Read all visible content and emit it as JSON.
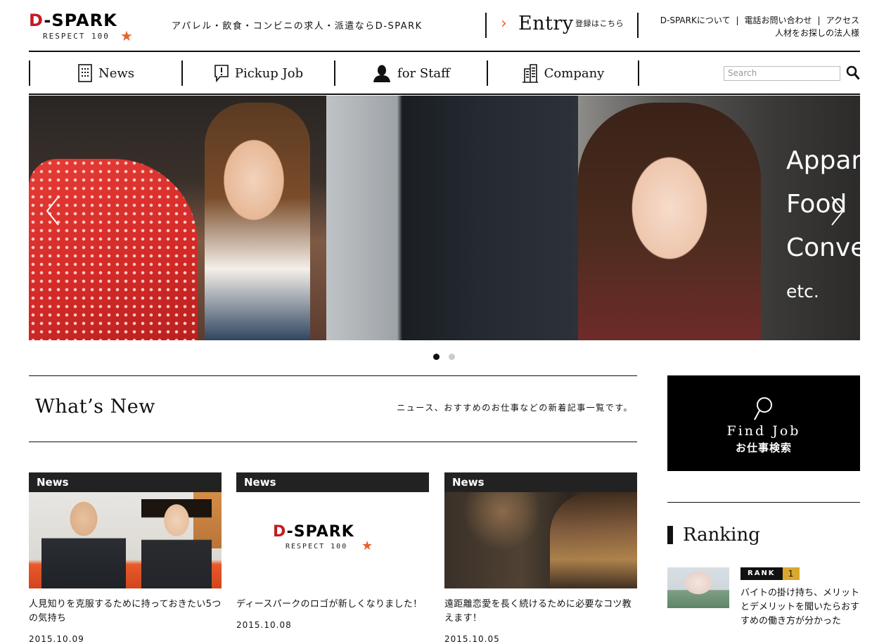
{
  "header": {
    "logo": {
      "main_d": "D",
      "main_rest": "-SPARK",
      "sub": "RESPECT 100",
      "star": "★"
    },
    "tagline": "アパレル・飲食・コンビニの求人・派遣ならD-SPARK",
    "entry": {
      "label": "Entry",
      "sub": "登録はこちら"
    },
    "links": [
      "D-SPARKについて",
      "電話お問い合わせ",
      "アクセス"
    ],
    "link_corporate": "人材をお探しの法人様"
  },
  "nav": {
    "items": [
      {
        "label": "News",
        "icon": "document-icon"
      },
      {
        "label": "Pickup Job",
        "icon": "speech-bubble-icon"
      },
      {
        "label": "for Staff",
        "icon": "person-icon"
      },
      {
        "label": "Company",
        "icon": "building-icon"
      }
    ],
    "search_placeholder": "Search"
  },
  "hero": {
    "lines": [
      "Appare",
      "Food",
      "Conve",
      "etc."
    ],
    "slides_total": 2,
    "active_slide": 1
  },
  "whats_new": {
    "title": "What’s New",
    "description": "ニュース、おすすめのお仕事などの新着記事一覧です。"
  },
  "cards": [
    {
      "tag": "News",
      "title": "人見知りを克服するために持っておきたい5つの気持ち",
      "date": "2015.10.09"
    },
    {
      "tag": "News",
      "title": "ディースパークのロゴが新しくなりました！",
      "date": "2015.10.08"
    },
    {
      "tag": "News",
      "title": "遠距離恋愛を長く続けるために必要なコツ教えます！",
      "date": "2015.10.05"
    }
  ],
  "find_job": {
    "en": "Find Job",
    "ja": "お仕事検索"
  },
  "ranking": {
    "title": "Ranking",
    "items": [
      {
        "rank_label": "RANK",
        "rank": "1",
        "text": "バイトの掛け持ち、メリットとデメリットを聞いたらおすすめの働き方が分かった"
      }
    ]
  },
  "colors": {
    "brand_red": "#c41a22",
    "accent_orange": "#e8612c",
    "rank_gold": "#d9a82c"
  }
}
